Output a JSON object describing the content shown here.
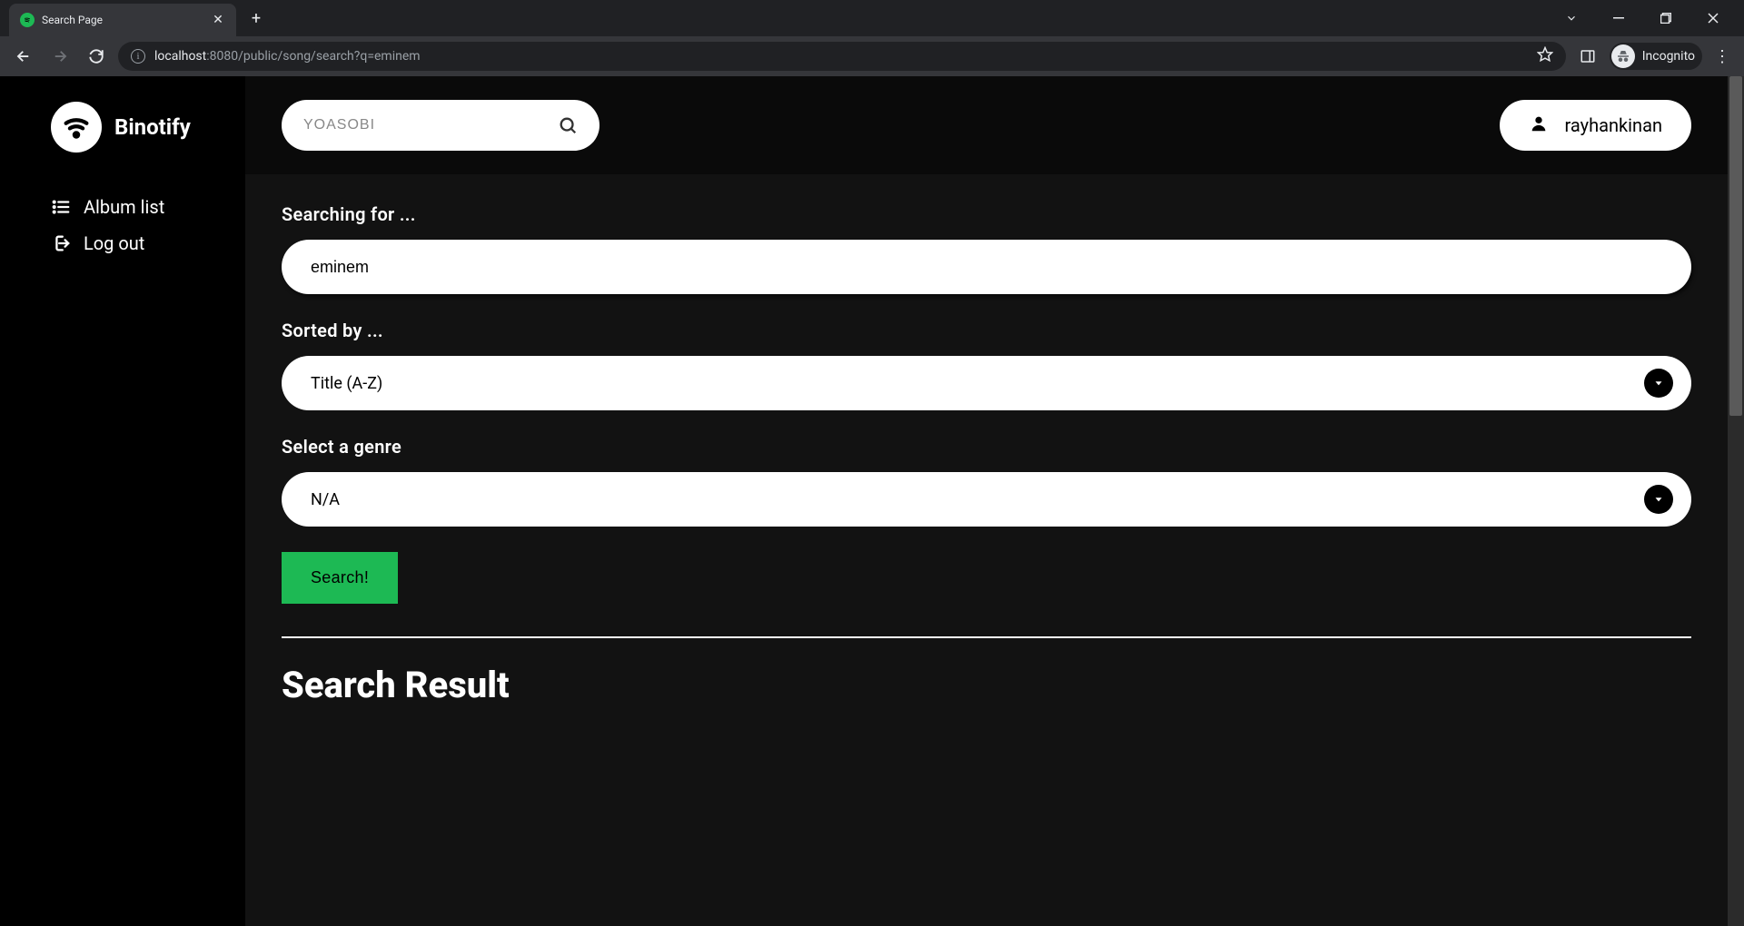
{
  "browser": {
    "tab_title": "Search Page",
    "url_host": "localhost",
    "url_port": ":8080",
    "url_path": "/public/song/search?q=eminem",
    "incognito_label": "Incognito"
  },
  "sidebar": {
    "app_name": "Binotify",
    "items": [
      {
        "label": "Album list"
      },
      {
        "label": "Log out"
      }
    ]
  },
  "topbar": {
    "search_placeholder": "YOASOBI",
    "username": "rayhankinan"
  },
  "form": {
    "searching_label": "Searching for ...",
    "query_value": "eminem",
    "sorted_label": "Sorted by ...",
    "sort_value": "Title (A-Z)",
    "genre_label": "Select a genre",
    "genre_value": "N/A",
    "submit_label": "Search!"
  },
  "results": {
    "heading": "Search Result"
  }
}
